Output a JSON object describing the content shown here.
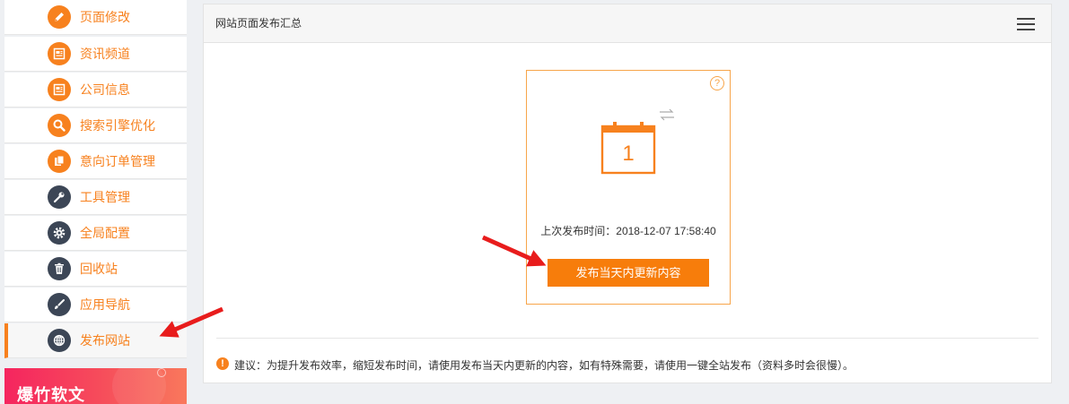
{
  "sidebar": {
    "items": [
      {
        "label": "页面修改",
        "icon": "pencil-icon"
      },
      {
        "label": "资讯频道",
        "icon": "news-icon"
      },
      {
        "label": "公司信息",
        "icon": "company-info-icon"
      },
      {
        "label": "搜索引擎优化",
        "icon": "search-icon"
      },
      {
        "label": "意向订单管理",
        "icon": "order-icon"
      },
      {
        "label": "工具管理",
        "icon": "wrench-icon"
      },
      {
        "label": "全局配置",
        "icon": "gear-icon"
      },
      {
        "label": "回收站",
        "icon": "trash-icon"
      },
      {
        "label": "应用导航",
        "icon": "brush-icon"
      },
      {
        "label": "发布网站",
        "icon": "globe-icon"
      }
    ],
    "promo_text": "爆竹软文"
  },
  "panel": {
    "title": "网站页面发布汇总",
    "calendar_day": "1",
    "help_symbol": "?",
    "last_publish": "上次发布时间：2018-12-07 17:58:40",
    "publish_button": "发布当天内更新内容",
    "tip_symbol": "!",
    "tip": "建议：为提升发布效率，缩短发布时间，请使用发布当天内更新的内容，如有特殊需要，请使用一键全站发布（资料多时会很慢）。"
  },
  "colors": {
    "accent": "#f7811e",
    "dark_icon": "#3c4656",
    "annotation_arrow": "#e81c1c"
  }
}
